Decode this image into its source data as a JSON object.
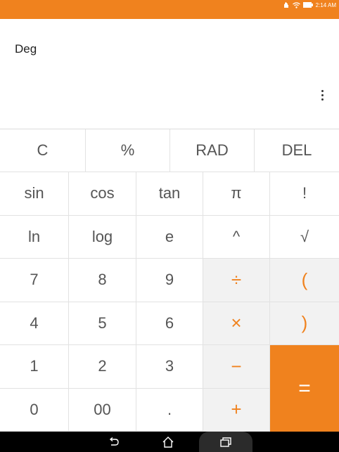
{
  "status_bar": {
    "time": "2:14 AM",
    "accent_color": "#f0821e",
    "icons": [
      "hand-icon",
      "wifi-icon",
      "battery-icon"
    ]
  },
  "display": {
    "angle_mode": "Deg",
    "menu_icon": "more-vertical-icon"
  },
  "keypad": {
    "top_row": [
      "C",
      "%",
      "RAD",
      "DEL"
    ],
    "function_rows": [
      [
        "sin",
        "cos",
        "tan",
        "π",
        "!"
      ],
      [
        "ln",
        "log",
        "e",
        "^",
        "√"
      ]
    ],
    "number_rows": [
      [
        "7",
        "8",
        "9",
        "÷",
        "("
      ],
      [
        "4",
        "5",
        "6",
        "×",
        ")"
      ],
      [
        "1",
        "2",
        "3",
        "−"
      ],
      [
        "0",
        "00",
        ".",
        "+"
      ]
    ],
    "equals": "="
  },
  "navigation": {
    "buttons": [
      "back-icon",
      "home-icon",
      "recent-apps-icon"
    ]
  }
}
